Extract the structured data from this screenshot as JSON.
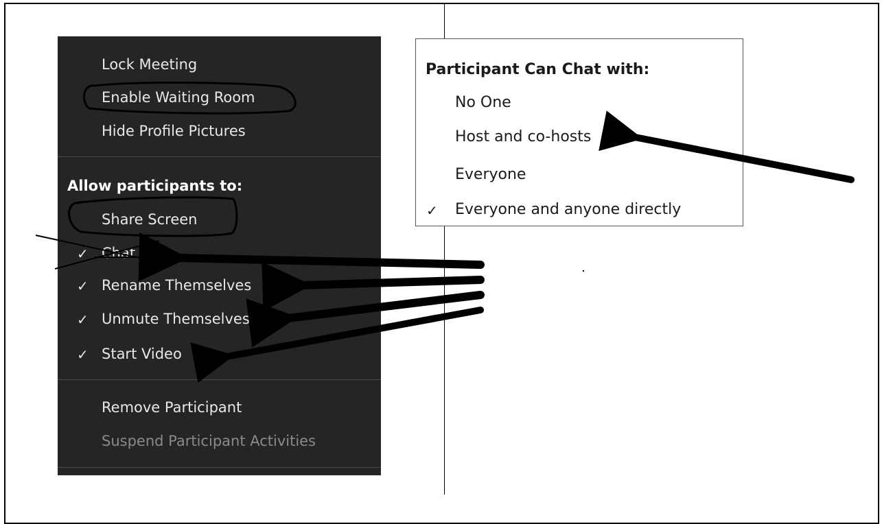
{
  "security_menu": {
    "lock_meeting": "Lock Meeting",
    "enable_waiting_room": "Enable Waiting Room",
    "hide_profile_pictures": "Hide Profile Pictures",
    "allow_heading": "Allow participants to:",
    "share_screen": "Share Screen",
    "chat": "Chat",
    "rename_themselves": "Rename Themselves",
    "unmute_themselves": "Unmute Themselves",
    "start_video": "Start Video",
    "remove_participant": "Remove Participant",
    "suspend_activities": "Suspend Participant Activities",
    "check_glyph": "✓"
  },
  "chat_submenu": {
    "title": "Participant Can Chat with:",
    "options": [
      "No One",
      "Host and co-hosts",
      "Everyone",
      "Everyone and anyone directly"
    ],
    "selected_index": 3,
    "check_glyph": "✓"
  },
  "colors": {
    "menu_bg": "#252525",
    "menu_text": "#e8e8e8",
    "disabled_text": "#8a8a8a",
    "annotation": "#000000"
  }
}
